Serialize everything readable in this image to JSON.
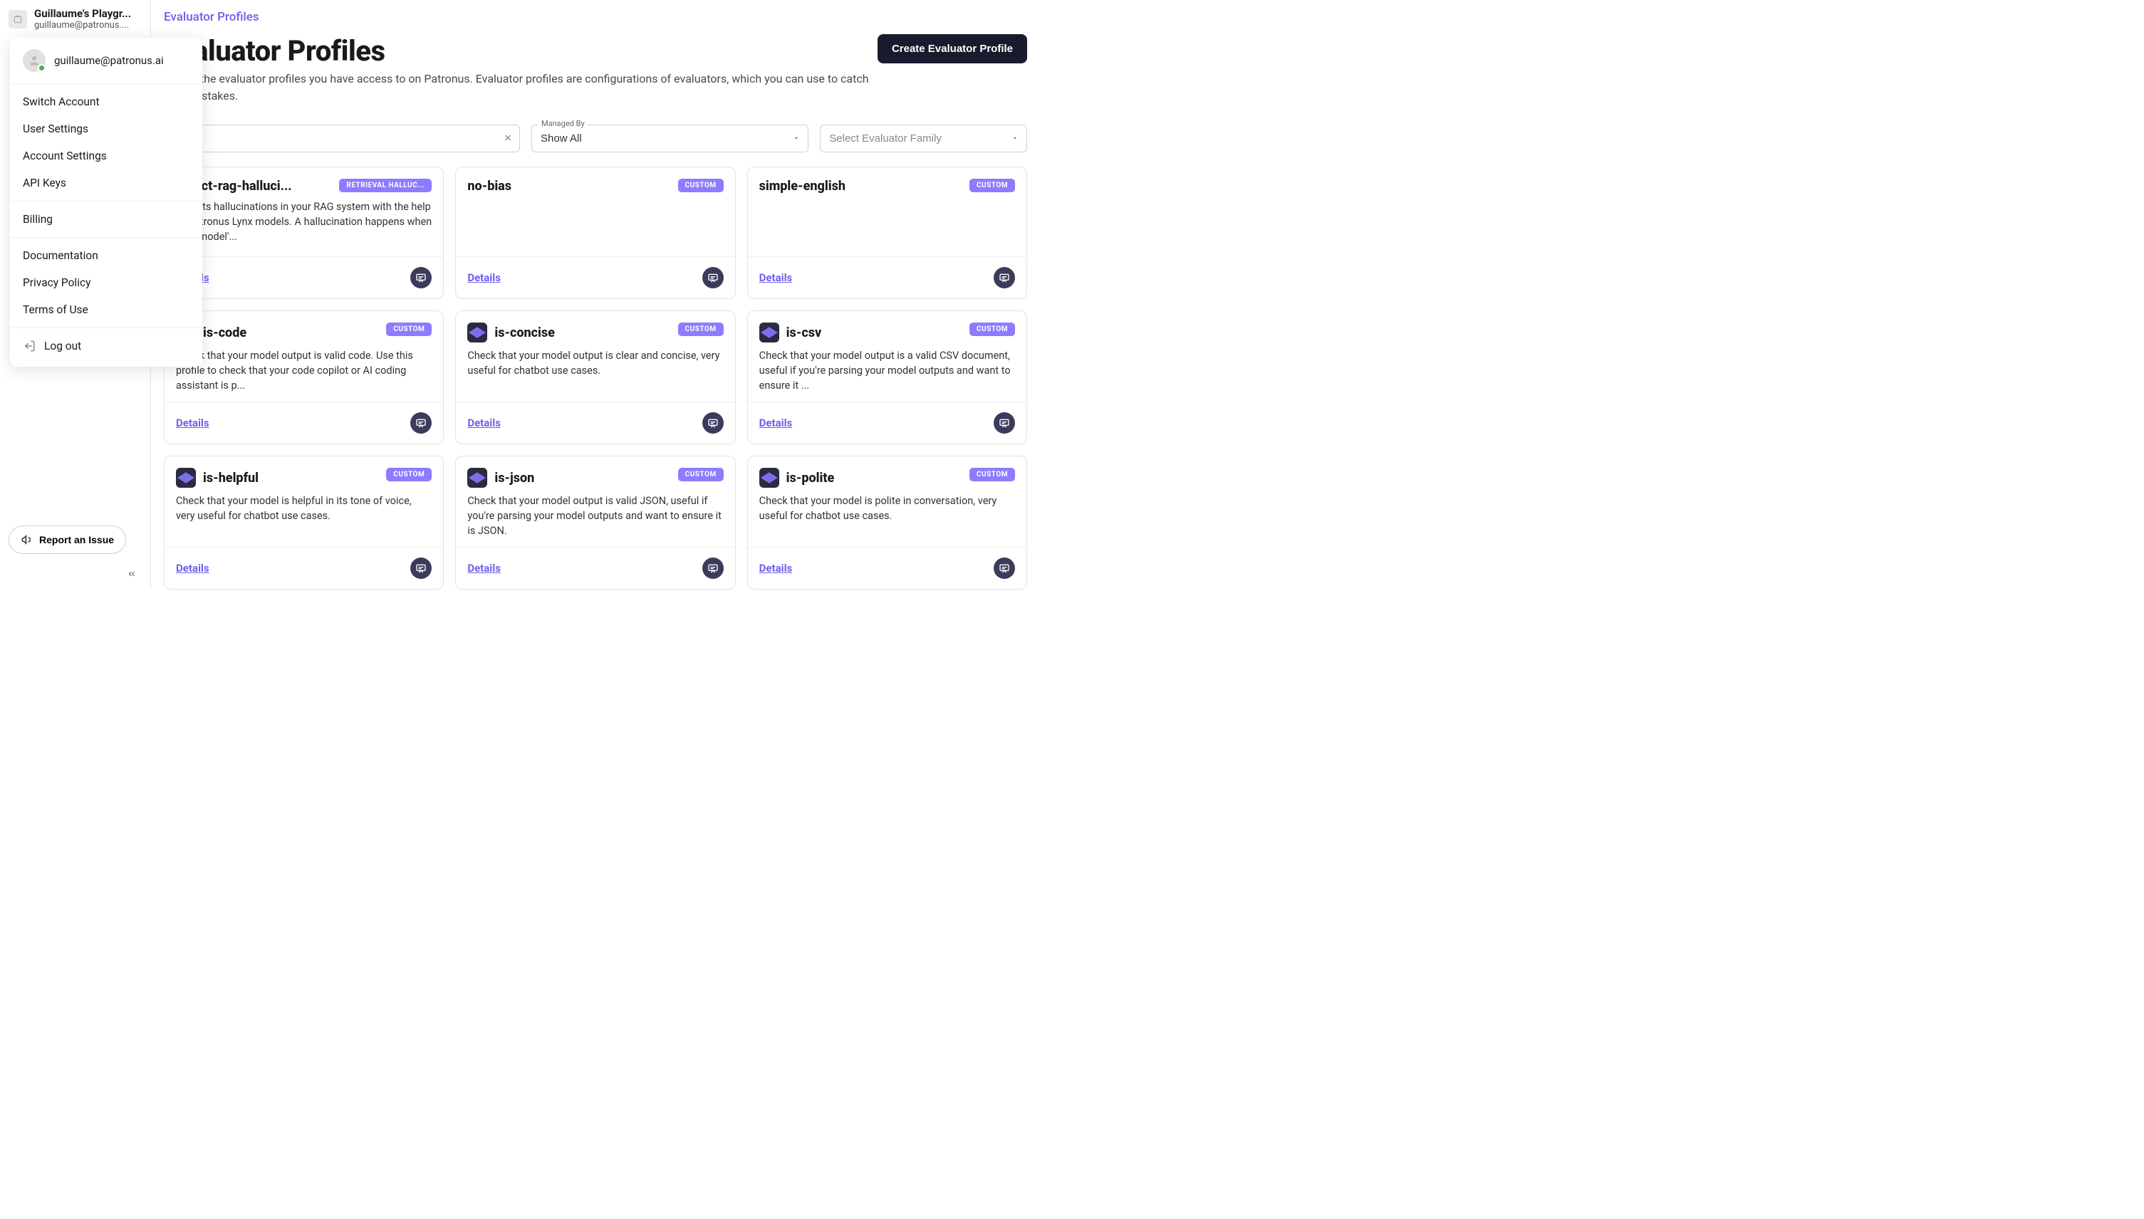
{
  "sidebar": {
    "org_name": "Guillaume's Playgr...",
    "org_email": "guillaume@patronus....",
    "report_label": "Report an Issue"
  },
  "user_menu": {
    "email": "guillaume@patronus.ai",
    "sections": [
      [
        "Switch Account",
        "User Settings",
        "Account Settings",
        "API Keys"
      ],
      [
        "Billing"
      ],
      [
        "Documentation",
        "Privacy Policy",
        "Terms of Use"
      ],
      [
        "Log out"
      ]
    ]
  },
  "breadcrumb": "Evaluator Profiles",
  "page": {
    "title": "Evaluator Profiles",
    "subtitle": "See all the evaluator profiles you have access to on Patronus. Evaluator profiles are configurations of evaluators, which you can use to catch LLM mistakes.",
    "create_button": "Create Evaluator Profile"
  },
  "filters": {
    "search_value": "",
    "managed_by_label": "Managed By",
    "managed_by_value": "Show All",
    "family_placeholder": "Select Evaluator Family"
  },
  "details_label": "Details",
  "cards": [
    {
      "title": "detect-rag-halluci...",
      "badge": "RETRIEVAL HALLUC...",
      "desc": "Detects hallucinations in your RAG system with the help of Patronus Lynx models. A hallucination happens when your model'..."
    },
    {
      "title": "no-bias",
      "badge": "CUSTOM",
      "desc": ""
    },
    {
      "title": "simple-english",
      "badge": "CUSTOM",
      "desc": ""
    },
    {
      "title": "is-code",
      "badge": "CUSTOM",
      "desc": "Check that your model output is valid code. Use this profile to check that your code copilot or AI coding assistant is p..."
    },
    {
      "title": "is-concise",
      "badge": "CUSTOM",
      "desc": "Check that your model output is clear and concise, very useful for chatbot use cases."
    },
    {
      "title": "is-csv",
      "badge": "CUSTOM",
      "desc": "Check that your model output is a valid CSV document, useful if you're parsing your model outputs and want to ensure it ..."
    },
    {
      "title": "is-helpful",
      "badge": "CUSTOM",
      "desc": "Check that your model is helpful in its tone of voice, very useful for chatbot use cases."
    },
    {
      "title": "is-json",
      "badge": "CUSTOM",
      "desc": "Check that your model output is valid JSON, useful if you're parsing your model outputs and want to ensure it is JSON."
    },
    {
      "title": "is-polite",
      "badge": "CUSTOM",
      "desc": "Check that your model is polite in conversation, very useful for chatbot use cases."
    }
  ]
}
